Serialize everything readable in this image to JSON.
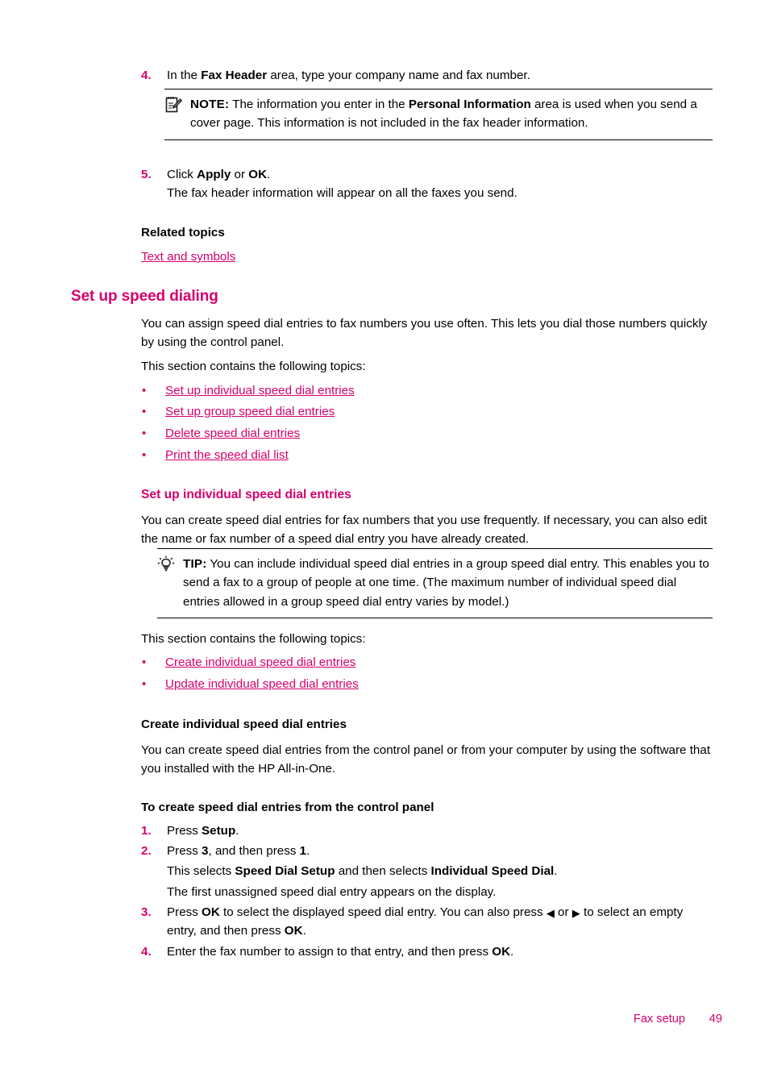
{
  "document": {
    "footer": {
      "section": "Fax setup",
      "page_number": "49"
    },
    "accent_color": "#d6006e",
    "text_color": "#000000"
  },
  "steps_top": [
    {
      "num": "4.",
      "parts": [
        {
          "t": "In the ",
          "b": false
        },
        {
          "t": "Fax Header",
          "b": true
        },
        {
          "t": " area, type your company name and fax number.",
          "b": false
        }
      ]
    },
    {
      "num": "5.",
      "parts": [
        {
          "t": "Click ",
          "b": false
        },
        {
          "t": "Apply",
          "b": true
        },
        {
          "t": " or ",
          "b": false
        },
        {
          "t": "OK",
          "b": true
        },
        {
          "t": ".",
          "b": false
        }
      ]
    }
  ],
  "step5_detail": "The fax header information will appear on all the faxes you send.",
  "note_box": {
    "icon": "note-pad-pencil-icon",
    "label": "NOTE:",
    "parts": [
      {
        "t": "   The information you enter in the ",
        "b": false
      },
      {
        "t": "Personal Information",
        "b": true
      },
      {
        "t": " area is used when you send a cover page. This information is not included in the fax header information.",
        "b": false
      }
    ]
  },
  "related": {
    "heading": "Related topics",
    "link": "Text and symbols"
  },
  "section": {
    "heading": "Set up speed dialing",
    "intro": "You can assign speed dial entries to fax numbers you use often. This lets you dial those numbers quickly by using the control panel.",
    "toc_lead": "This section contains the following topics:",
    "toc": [
      "Set up individual speed dial entries",
      "Set up group speed dial entries",
      "Delete speed dial entries",
      "Print the speed dial list"
    ]
  },
  "subsection": {
    "heading": "Set up individual speed dial entries",
    "intro": "You can create speed dial entries for fax numbers that you use frequently. If necessary, you can also edit the name or fax number of a speed dial entry you have already created.",
    "tip_box": {
      "icon": "lightbulb-icon",
      "label": "TIP:",
      "text": "   You can include individual speed dial entries in a group speed dial entry. This enables you to send a fax to a group of people at one time. (The maximum number of individual speed dial entries allowed in a group speed dial entry varies by model.)"
    },
    "toc_lead": "This section contains the following topics:",
    "toc": [
      "Create individual speed dial entries",
      "Update individual speed dial entries"
    ]
  },
  "subsubsection": {
    "heading": "Create individual speed dial entries",
    "intro": "You can create speed dial entries from the control panel or from your computer by using the software that you installed with the HP All-in-One."
  },
  "procedure": {
    "heading": "To create speed dial entries from the control panel",
    "steps": [
      {
        "num": "1.",
        "lines": [
          {
            "parts": [
              {
                "t": "Press ",
                "b": false
              },
              {
                "t": "Setup",
                "b": true
              },
              {
                "t": ".",
                "b": false
              }
            ]
          }
        ]
      },
      {
        "num": "2.",
        "lines": [
          {
            "parts": [
              {
                "t": "Press ",
                "b": false
              },
              {
                "t": "3",
                "b": true
              },
              {
                "t": ", and then press ",
                "b": false
              },
              {
                "t": "1",
                "b": true
              },
              {
                "t": ".",
                "b": false
              }
            ]
          },
          {
            "parts": [
              {
                "t": "This selects ",
                "b": false
              },
              {
                "t": "Speed Dial Setup",
                "b": true
              },
              {
                "t": " and then selects ",
                "b": false
              },
              {
                "t": "Individual Speed Dial",
                "b": true
              },
              {
                "t": ".",
                "b": false
              }
            ]
          },
          {
            "parts": [
              {
                "t": "The first unassigned speed dial entry appears on the display.",
                "b": false
              }
            ]
          }
        ]
      },
      {
        "num": "3.",
        "lines": [
          {
            "parts": [
              {
                "t": "Press ",
                "b": false
              },
              {
                "t": "OK",
                "b": true
              },
              {
                "t": " to select the displayed speed dial entry. You can also press ",
                "b": false
              },
              {
                "t": "◀",
                "b": false,
                "glyph": "left-arrow-icon"
              },
              {
                "t": " or ",
                "b": false
              },
              {
                "t": "▶",
                "b": false,
                "glyph": "right-arrow-icon"
              },
              {
                "t": " to select an empty entry, and then press ",
                "b": false
              },
              {
                "t": "OK",
                "b": true
              },
              {
                "t": ".",
                "b": false
              }
            ]
          }
        ]
      },
      {
        "num": "4.",
        "lines": [
          {
            "parts": [
              {
                "t": "Enter the fax number to assign to that entry, and then press ",
                "b": false
              },
              {
                "t": "OK",
                "b": true
              },
              {
                "t": ".",
                "b": false
              }
            ]
          }
        ]
      }
    ]
  }
}
